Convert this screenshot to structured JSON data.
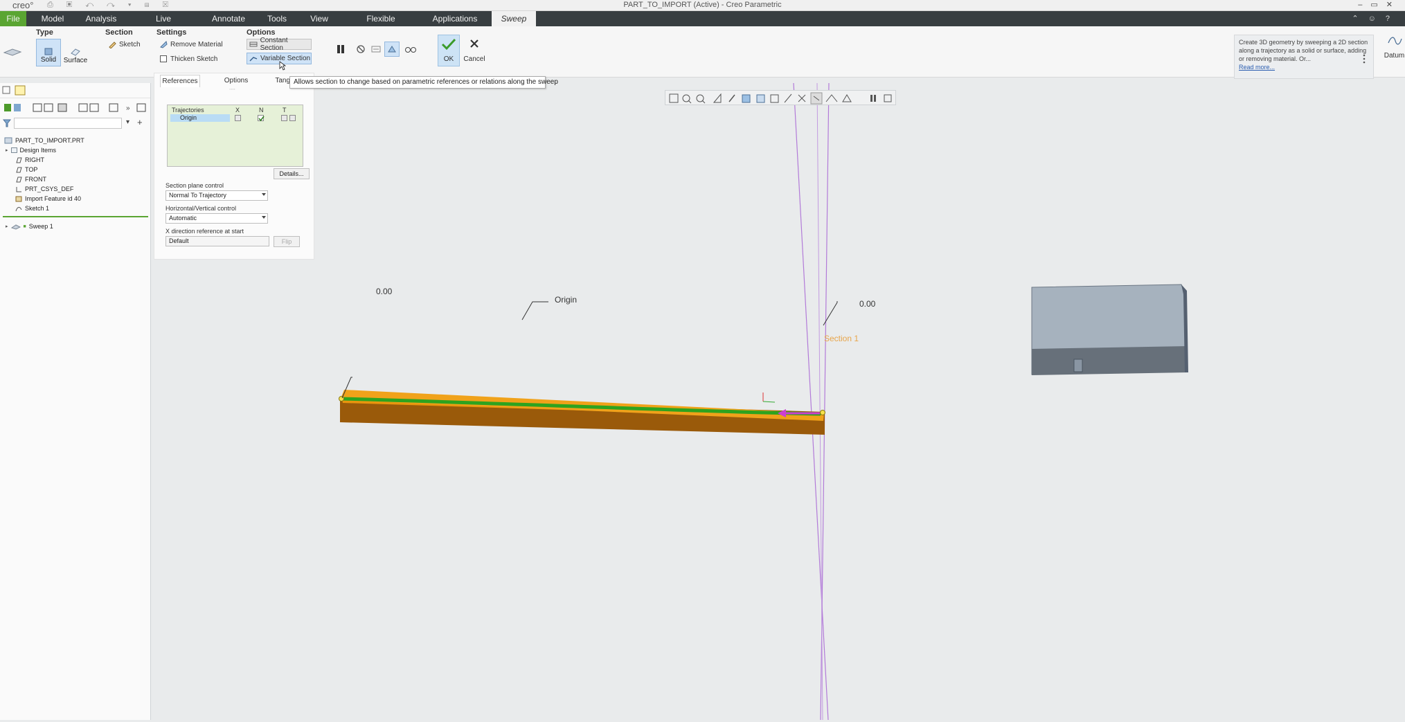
{
  "window": {
    "logo": "creo°",
    "title": "PART_TO_IMPORT (Active) - Creo Parametric",
    "quick_access": "⎙ ▣ ↶ ↷ ▾ ⊞ ☒"
  },
  "menu": {
    "tabs": [
      "File",
      "Model",
      "Analysis",
      "Live Simulation",
      "Annotate",
      "Tools",
      "View",
      "Flexible Modeling",
      "Applications",
      "Sweep"
    ],
    "active_tab": "Sweep"
  },
  "ribbon": {
    "type_group": "Type",
    "type_solid": "Solid",
    "type_surface": "Surface",
    "section_group": "Section",
    "section_sketch": "Sketch",
    "settings_group": "Settings",
    "remove_material": "Remove Material",
    "thicken_sketch": "Thicken Sketch",
    "options_group": "Options",
    "constant_section": "Constant Section",
    "variable_section": "Variable Section",
    "ok_label": "OK",
    "cancel_label": "Cancel",
    "info_text": "Create 3D geometry by sweeping a 2D section along a trajectory as a solid or surface, adding or removing material. Or...",
    "read_more": "Read more...",
    "datum_label": "Datum"
  },
  "tooltip": "Allows section to change based on parametric references or relations along the sweep",
  "tree": {
    "root": "PART_TO_IMPORT.PRT",
    "items": [
      "Design Items",
      "RIGHT",
      "TOP",
      "FRONT",
      "PRT_CSYS_DEF",
      "Import Feature id 40",
      "Sketch 1"
    ],
    "insert_item": "Sweep 1"
  },
  "dashboard": {
    "tabs": [
      "References",
      "Options",
      "Tange"
    ],
    "table_headers": [
      "Trajectories",
      "X",
      "N",
      "T"
    ],
    "trajectory_row": "Origin",
    "details_button": "Details...",
    "section_plane_label": "Section plane control",
    "section_plane_value": "Normal To Trajectory",
    "hv_label": "Horizontal/Vertical control",
    "hv_value": "Automatic",
    "xdir_label": "X direction reference at start",
    "xdir_value": "Default",
    "flip_button": "Flip"
  },
  "viewport": {
    "dim_left": "0.00",
    "dim_right": "0.00",
    "trajectory_label": "Origin",
    "section_label": "Section 1"
  },
  "colors": {
    "menu_bar": "#383e41",
    "file_tab": "#5aa532",
    "sweep_orange": "#e8950d",
    "sweep_dark": "#9a5a0a",
    "trajectory_green": "#2ea31f",
    "datum_purple": "#b27ad8",
    "block_gray": "#a6b2be"
  }
}
